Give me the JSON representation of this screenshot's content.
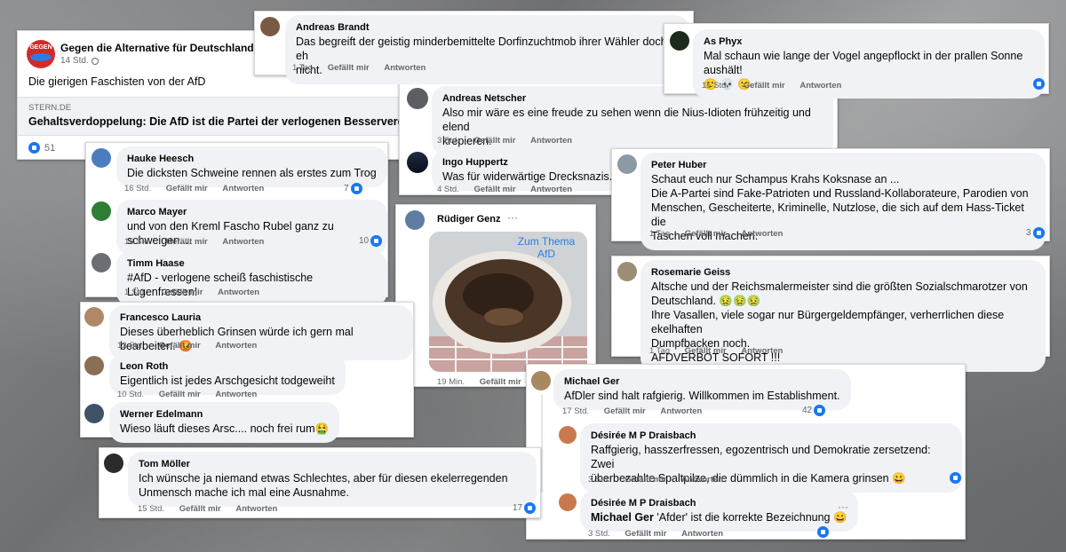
{
  "post": {
    "page_name": "Gegen die Alternative für Deutschland",
    "time": "14 Std.",
    "text": "Die gierigen Faschisten von der AfD",
    "link_source": "STERN.DE",
    "link_title": "Gehaltsverdoppelung: Die AfD ist die Partei der verlogenen Besserverdie",
    "reactions": "51",
    "logo_text": "GEGEN"
  },
  "comments": {
    "andreas_brandt": {
      "name": "Andreas Brandt",
      "text": "Das begreift der geistig minderbemittelte Dorfinzuchtmob ihrer Wähler doch eh\nnicht.",
      "time": "1 Tag",
      "like": "Gefällt mir",
      "reply": "Antworten"
    },
    "as_phyx": {
      "name": "As Phyx",
      "text": "Mal schaun wie lange der Vogel angepflockt in der prallen Sonne aushält!\n🙂 💀 🙂",
      "time": "15 Std.",
      "like": "Gefällt mir",
      "reply": "Antworten"
    },
    "andreas_netscher": {
      "name": "Andreas Netscher",
      "text": "Also mir wäre es eine freude zu sehen wenn die Nius-Idioten frühzeitig und elend\nkrepieren.",
      "time": "3 Std.",
      "like": "Gefällt mir",
      "reply": "Antworten"
    },
    "ingo_huppertz": {
      "name": "Ingo Huppertz",
      "text": "Was für widerwärtige Drecksnazis.",
      "time": "4 Std.",
      "like": "Gefällt mir",
      "reply": "Antworten"
    },
    "peter_huber": {
      "name": "Peter Huber",
      "text": "Schaut euch nur Schampus Krahs Koksnase an ...\nDie A-Partei sind Fake-Patrioten und Russland-Kollaborateure, Parodien von\nMenschen, Gescheiterte, Kriminelle, Nutzlose, die sich auf dem Hass-Ticket die\nTaschen voll machen.",
      "time": "1 Tag",
      "like": "Gefällt mir",
      "reply": "Antworten",
      "count": "3"
    },
    "hauke_heesch": {
      "name": "Hauke Heesch",
      "text": "Die dicksten Schweine rennen als erstes zum Trog",
      "time": "16 Std.",
      "like": "Gefällt mir",
      "reply": "Antworten",
      "count": "7"
    },
    "marco_mayer": {
      "name": "Marco Mayer",
      "text": "und von den Kreml Fascho Rubel ganz zu schweigen....",
      "time": "16 Std.",
      "like": "Gefällt mir",
      "reply": "Antworten",
      "count": "10"
    },
    "timm_haase": {
      "name": "Timm Haase",
      "text": "#AfD - verlogene scheiß faschistische Lügenfressen!",
      "time": "1 Std.",
      "like": "Gefällt mir",
      "reply": "Antworten"
    },
    "ruediger_genz": {
      "name": "Rüdiger Genz",
      "image_caption": "Zum Thema\nAfD",
      "time": "19 Min.",
      "like": "Gefällt mir",
      "more": "···"
    },
    "rosemarie_geiss": {
      "name": "Rosemarie Geiss",
      "text": "Altsche und der Reichsmalermeister sind die größten Sozialschmarotzer von\nDeutschland. 🤢🤢🤢\nIhre Vasallen, viele sogar nur Bürgergeldempfänger, verherrlichen diese ekelhaften\nDumpfbacken noch.\nAFDVERBOT SOFORT !!!",
      "time": "1 Tag",
      "like": "Gefällt mir",
      "reply": "Antworten"
    },
    "francesco_lauria": {
      "name": "Francesco Lauria",
      "text": "Dieses überheblich Grinsen würde ich gern mal bearbeiten. 😡",
      "time": "12 Std.",
      "like": "Gefällt mir",
      "reply": "Antworten"
    },
    "leon_roth": {
      "name": "Leon Roth",
      "text": "Eigentlich ist jedes Arschgesicht todgeweiht",
      "time": "10 Std.",
      "like": "Gefällt mir",
      "reply": "Antworten"
    },
    "werner_edelmann": {
      "name": "Werner Edelmann",
      "text": "Wieso läuft dieses Arsc.... noch frei rum🤮"
    },
    "michael_ger": {
      "name": "Michael Ger",
      "text": "AfDler sind halt rafgierig. Willkommen im Establishment.",
      "time": "17 Std.",
      "like": "Gefällt mir",
      "reply": "Antworten",
      "count": "42"
    },
    "desiree_1": {
      "name": "Désirée M P Draisbach",
      "text": "Raffgierig, hasszerfressen, egozentrisch und Demokratie zersetzend: Zwei\nüberbezahlte Spaltpilze, die dümmlich in die Kamera grinsen 😀",
      "time": "3 Std.",
      "like": "Gefällt mir",
      "reply": "Antworten"
    },
    "desiree_2": {
      "name": "Désirée M P Draisbach",
      "mention": "Michael Ger",
      "text": " 'Afder' ist die korrekte Bezeichnung 😀",
      "time": "3 Std.",
      "like": "Gefällt mir",
      "reply": "Antworten",
      "more": "···"
    },
    "tom_moeller": {
      "name": "Tom Möller",
      "text": "Ich wünsche ja niemand etwas Schlechtes, aber für diesen ekelerregenden\nUnmensch mache ich mal eine Ausnahme.",
      "time": "15 Std.",
      "like": "Gefällt mir",
      "reply": "Antworten",
      "count": "17"
    }
  },
  "colors": {
    "like_blue": "#1877f2",
    "bubble": "#f0f2f5",
    "meta_gray": "#65676b"
  }
}
